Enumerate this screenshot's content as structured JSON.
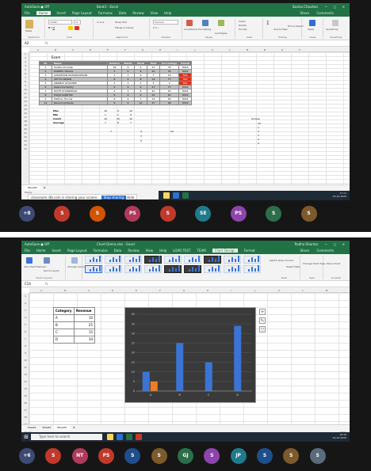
{
  "top": {
    "app_title": "AutoSave  ● Off",
    "file_name": "Book1 - Excel",
    "user_name": "Sanika Chouhan",
    "window_controls": "—  ▢  ✕",
    "menu": [
      "File",
      "Home",
      "Insert",
      "Page Layout",
      "Formulas",
      "Data",
      "Review",
      "View",
      "Help"
    ],
    "menu_active": "Home",
    "share_label": "Share",
    "comments_label": "Comments",
    "ribbon_groups": [
      "Clipboard",
      "Font",
      "Alignment",
      "Number",
      "Styles",
      "Cells",
      "Editing",
      "Ideas",
      "Sensitivity"
    ],
    "ribbon_labels": {
      "paste": "Paste",
      "font_name": "Calibri",
      "font_size": "11",
      "wrap_text": "Wrap Text",
      "merge_center": "Merge & Center",
      "number_format": "General",
      "conditional": "Conditional Formatting",
      "format_table": "Format as Table",
      "cell_styles": "Cell Styles",
      "insert": "Insert",
      "delete": "Delete",
      "format": "Format",
      "sort_filter": "Sort & Filter",
      "find_select": "Find & Select",
      "ideas": "Ideas",
      "sensitivity": "Sensitivity"
    },
    "name_box": "A2",
    "formula_fx": "fx",
    "columns": [
      "A",
      "B",
      "C",
      "D",
      "E",
      "F",
      "G",
      "H",
      "I",
      "J",
      "K",
      "L",
      "M",
      "N",
      "O",
      "P"
    ],
    "rows": [
      "1",
      "2",
      "3",
      "4",
      "5",
      "6",
      "7",
      "8",
      "9",
      "10",
      "11",
      "12",
      "13",
      "14",
      "15",
      "16",
      "17",
      "18",
      "19",
      "20",
      "21",
      "22",
      "23",
      "24",
      "25"
    ],
    "table_title": "Exam",
    "table_headers": [
      "Sr.",
      "Name",
      "Science",
      "Maths",
      "Hindi",
      "Total",
      "Percentage",
      "Result"
    ],
    "table_rows": [
      [
        "1",
        "Sanika Chouhan",
        "18",
        "9",
        "9",
        "27",
        "76",
        "PASS"
      ],
      [
        "2",
        "PARBHU VIKAAS",
        "2",
        "6",
        "9",
        "20",
        "55",
        "PASS"
      ],
      [
        "3",
        "JAIKRISHAN MAHARASHIDAR",
        "1",
        "1",
        "9",
        "7",
        "19",
        "FAIL"
      ],
      [
        "4",
        "ADITYA PAWAR",
        "8",
        "9",
        "8",
        "19",
        "77",
        "FAIL"
      ],
      [
        "5",
        "ANIRBAT GHOSHEE",
        "1",
        "1",
        "1",
        "3",
        "9",
        "FAIL"
      ],
      [
        "6",
        "Rashmika Reddy",
        "9",
        "9",
        "9",
        "27",
        "77",
        "PASS"
      ],
      [
        "7",
        "ROHIT KHANDEKAR",
        "9",
        "3",
        "8",
        "20",
        "55",
        "PASS"
      ],
      [
        "8",
        "POOJA RAJBHAR",
        "9",
        "4",
        "9",
        "22",
        "61",
        "PASS"
      ],
      [
        "9",
        "Madhav Honnal",
        "8",
        "9",
        "7",
        "24",
        "65",
        "PASS"
      ],
      [
        "10",
        "Naved Lambade",
        "9",
        "9",
        "10",
        "27",
        "96",
        "PASS"
      ]
    ],
    "stats": [
      {
        "label": "Max",
        "values": [
          "10",
          "9",
          "10"
        ]
      },
      {
        "label": "Min",
        "values": [
          "1",
          "1",
          "9"
        ]
      },
      {
        "label": "Count",
        "values": [
          "10",
          "10",
          "10"
        ]
      },
      {
        "label": "Average",
        "values": [
          "7",
          "6",
          "7"
        ]
      }
    ],
    "unique_label": "Unique",
    "extra_values_c": [
      "7",
      "4",
      "10"
    ],
    "extra_values_e": [
      "7",
      "3"
    ],
    "unique_values": [
      "10",
      "1",
      "3",
      "7",
      "4",
      "2"
    ],
    "sheet_tabs": [
      "Sheet1"
    ],
    "status_text": "Ready",
    "status_right": "Average: 7.90476931   Count: 90   Sum: 206",
    "zoom": "100%",
    "share_msg": "classroom.iitb.com is sharing your screen.",
    "stop_sharing": "Stop sharing",
    "hide": "Hide",
    "tray_time": "17:11",
    "tray_date": "03-10-2020",
    "participants": [
      {
        "initials": "+8",
        "color": "#3d4a73"
      },
      {
        "initials": "S",
        "color": "#c0392b"
      },
      {
        "initials": "S",
        "color": "#d35400"
      },
      {
        "initials": "PS",
        "color": "#b03a5b"
      },
      {
        "initials": "S",
        "color": "#c0392b"
      },
      {
        "initials": "SE",
        "color": "#1f7a8c"
      },
      {
        "initials": "PS",
        "color": "#8e44ad"
      },
      {
        "initials": "S",
        "color": "#2c6e49"
      },
      {
        "initials": "S",
        "color": "#7d5a2c"
      }
    ]
  },
  "bottom": {
    "app_title": "AutoSave  ● Off",
    "file_name": "Chart Demo.xlsx - Excel",
    "user_name": "Radha Sharma",
    "window_controls": "—  ▢  ✕",
    "menu": [
      "File",
      "Home",
      "Insert",
      "Page Layout",
      "Formulas",
      "Data",
      "Review",
      "View",
      "Help",
      "LOAD TEST",
      "TEAM",
      "Chart Design",
      "Format"
    ],
    "menu_active": "Chart Design",
    "share_label": "Share",
    "comments_label": "Comments",
    "ribbon_labels": {
      "add_element": "Add Chart Element",
      "quick_layout": "Quick Layout",
      "change_colors": "Change Colors",
      "switch_row_col": "Switch Row/ Column",
      "select_data": "Select Data",
      "change_type": "Change Chart Type",
      "move_chart": "Move Chart"
    },
    "ribbon_groups": [
      "Chart Layouts",
      "Chart Styles",
      "Data",
      "Type",
      "Location"
    ],
    "name_box": "C14",
    "formula_fx": "fx",
    "columns": [
      "A",
      "B",
      "C",
      "D",
      "E",
      "F",
      "G",
      "H",
      "I",
      "J",
      "K",
      "L",
      "M",
      "N",
      "O"
    ],
    "rows": [
      "1",
      "2",
      "3",
      "4",
      "5",
      "6",
      "7",
      "8",
      "9",
      "10",
      "11",
      "12",
      "13",
      "14",
      "15",
      "16",
      "17",
      "18",
      "19",
      "20",
      "21"
    ],
    "table_headers": [
      "Category",
      "Revenue"
    ],
    "table_rows": [
      [
        "A",
        "10"
      ],
      [
        "B",
        "25"
      ],
      [
        "C",
        "15"
      ],
      [
        "D",
        "34"
      ]
    ],
    "sheet_tabs": [
      "Sheet1",
      "Sheet2",
      "Sheet3"
    ],
    "sheet_active": "Sheet3",
    "status_text": "Ready",
    "zoom": "100%",
    "search_placeholder": "Type here to search",
    "tray_time": "16:16",
    "tray_date": "01-10-2020",
    "participants": [
      {
        "initials": "+6",
        "color": "#3d4a73"
      },
      {
        "initials": "S",
        "color": "#c0392b"
      },
      {
        "initials": "NT",
        "color": "#b03a5b"
      },
      {
        "initials": "PS",
        "color": "#c0392b"
      },
      {
        "initials": "S",
        "color": "#1f4e8c"
      },
      {
        "initials": "S",
        "color": "#7d5a2c"
      },
      {
        "initials": "GJ",
        "color": "#2c6e49"
      },
      {
        "initials": "S",
        "color": "#8e44ad"
      },
      {
        "initials": "JP",
        "color": "#1f7a8c"
      },
      {
        "initials": "S",
        "color": "#1f4e8c"
      },
      {
        "initials": "S",
        "color": "#7d5a2c"
      },
      {
        "initials": "S",
        "color": "#5a6b7d"
      }
    ]
  },
  "chart_data": {
    "type": "bar",
    "categories": [
      "A",
      "B",
      "C",
      "D"
    ],
    "series": [
      {
        "values": [
          10,
          0,
          15,
          34
        ],
        "color": "#3a74d4"
      },
      {
        "values": [
          0,
          0,
          0,
          0
        ],
        "color": "#ef7d22"
      }
    ],
    "values_plotted": {
      "primary": [
        10,
        25,
        15,
        34
      ],
      "secondary_first": 5
    },
    "ylim": [
      0,
      40
    ],
    "yticks": [
      0,
      5,
      10,
      15,
      20,
      25,
      30,
      35,
      40
    ],
    "grid": true,
    "style": "dark"
  }
}
